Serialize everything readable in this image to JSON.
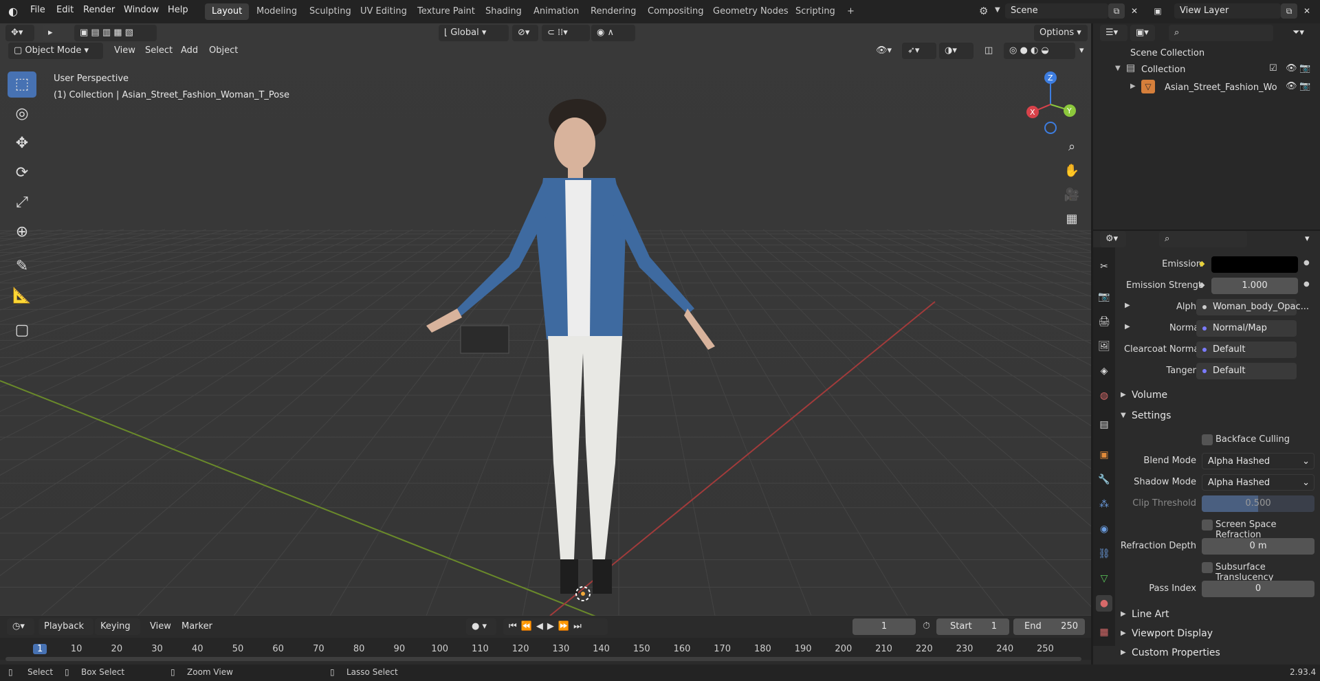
{
  "menus": [
    "File",
    "Edit",
    "Render",
    "Window",
    "Help"
  ],
  "workspaces": [
    "Layout",
    "Modeling",
    "Sculpting",
    "UV Editing",
    "Texture Paint",
    "Shading",
    "Animation",
    "Rendering",
    "Compositing",
    "Geometry Nodes",
    "Scripting",
    "+"
  ],
  "scene": {
    "label": "Scene",
    "view_layer": "View Layer"
  },
  "viewport": {
    "mode": "Object Mode",
    "menus": [
      "View",
      "Select",
      "Add",
      "Object"
    ],
    "transform_orientation": "Global",
    "options": "Options",
    "overlay_title": "User Perspective",
    "overlay_subtitle": "(1) Collection | Asian_Street_Fashion_Woman_T_Pose",
    "gizmo": {
      "x": "X",
      "y": "Y",
      "z": "Z"
    }
  },
  "outliner": {
    "scene_collection": "Scene Collection",
    "collection": "Collection",
    "object": "Asian_Street_Fashion_Wo"
  },
  "properties": {
    "emission_label": "Emission",
    "emission_color": "#000000",
    "emission_strength_label": "Emission Strengt",
    "emission_strength": "1.000",
    "alpha_label": "Alpha",
    "alpha_value": "Woman_body_Opac...",
    "normal_label": "Normal",
    "normal_value": "Normal/Map",
    "clearcoat_label": "Clearcoat Normal",
    "clearcoat_value": "Default",
    "tangent_label": "Tangent",
    "tangent_value": "Default",
    "volume_section": "Volume",
    "settings_section": "Settings",
    "backface_culling": "Backface Culling",
    "blend_mode_label": "Blend Mode",
    "blend_mode": "Alpha Hashed",
    "shadow_mode_label": "Shadow Mode",
    "shadow_mode": "Alpha Hashed",
    "clip_threshold_label": "Clip Threshold",
    "clip_threshold": "0.500",
    "ssr": "Screen Space Refraction",
    "refraction_depth_label": "Refraction Depth",
    "refraction_depth": "0 m",
    "subsurface_translucency": "Subsurface Translucency",
    "pass_index_label": "Pass Index",
    "pass_index": "0",
    "line_art": "Line Art",
    "viewport_display": "Viewport Display",
    "custom_properties": "Custom Properties"
  },
  "timeline": {
    "menus": [
      "Playback",
      "Keying",
      "View",
      "Marker"
    ],
    "current_frame": "1",
    "start_label": "Start",
    "start": "1",
    "end_label": "End",
    "end": "250",
    "ticks": [
      "1",
      "10",
      "20",
      "30",
      "40",
      "50",
      "60",
      "70",
      "80",
      "90",
      "100",
      "110",
      "120",
      "130",
      "140",
      "150",
      "160",
      "170",
      "180",
      "190",
      "200",
      "210",
      "220",
      "230",
      "240",
      "250"
    ]
  },
  "status": {
    "select": "Select",
    "box_select": "Box Select",
    "zoom_view": "Zoom View",
    "lasso_select": "Lasso Select",
    "version": "2.93.4"
  },
  "colors": {
    "accent": "#4772b3",
    "x_axis": "#d8424a",
    "y_axis": "#8cc83c",
    "z_axis": "#3d7de0"
  }
}
